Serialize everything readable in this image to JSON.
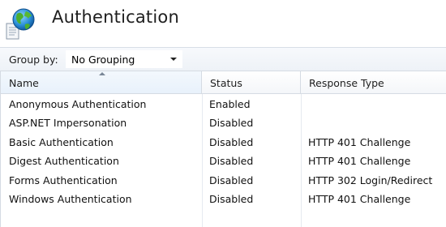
{
  "page": {
    "title": "Authentication",
    "icon": "authentication-feature-icon"
  },
  "toolbar": {
    "group_by_label": "Group by:",
    "group_by_value": "No Grouping"
  },
  "table": {
    "columns": [
      "Name",
      "Status",
      "Response Type"
    ],
    "sorted_column": "Name",
    "sort_direction": "ascending",
    "rows": [
      {
        "name": "Anonymous Authentication",
        "status": "Enabled",
        "response_type": ""
      },
      {
        "name": "ASP.NET Impersonation",
        "status": "Disabled",
        "response_type": ""
      },
      {
        "name": "Basic Authentication",
        "status": "Disabled",
        "response_type": "HTTP 401 Challenge"
      },
      {
        "name": "Digest Authentication",
        "status": "Disabled",
        "response_type": "HTTP 401 Challenge"
      },
      {
        "name": "Forms Authentication",
        "status": "Disabled",
        "response_type": "HTTP 302 Login/Redirect"
      },
      {
        "name": "Windows Authentication",
        "status": "Disabled",
        "response_type": "HTTP 401 Challenge"
      }
    ]
  }
}
